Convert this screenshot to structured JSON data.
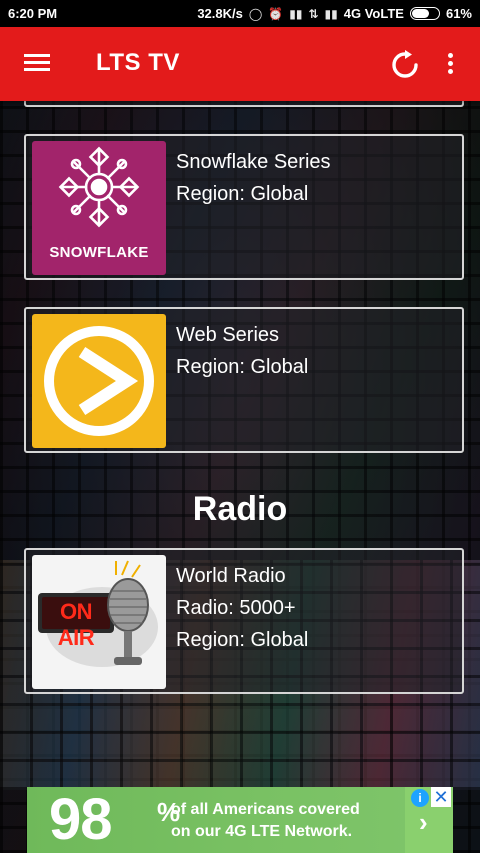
{
  "status_bar": {
    "time": "6:20 PM",
    "speed": "32.8K/s",
    "network": "4G VoLTE",
    "battery": "61%",
    "battery_level": 0.61
  },
  "app_bar": {
    "title": "LTS TV",
    "menu_icon": "hamburger-menu-icon",
    "refresh_icon": "refresh-icon",
    "more_icon": "more-vert-icon",
    "color": "#e31b1b"
  },
  "cards": [
    {
      "title": "Snowflake Series",
      "region": "Region: Global",
      "logo_text": "SNOWFLAKE",
      "thumb_color": "#a2246b"
    },
    {
      "title": "Web Series",
      "region": "Region: Global",
      "thumb_color": "#f4b71b"
    }
  ],
  "radio_section": {
    "heading": "Radio",
    "card": {
      "title": "World Radio",
      "count": "Radio: 5000+",
      "region": "Region: Global",
      "sign_text": "ON AIR"
    }
  },
  "ad": {
    "big_number": "98",
    "percent": "%",
    "line1": "of all Americans covered",
    "line2": "on our 4G LTE Network.",
    "background": "#79c163"
  }
}
